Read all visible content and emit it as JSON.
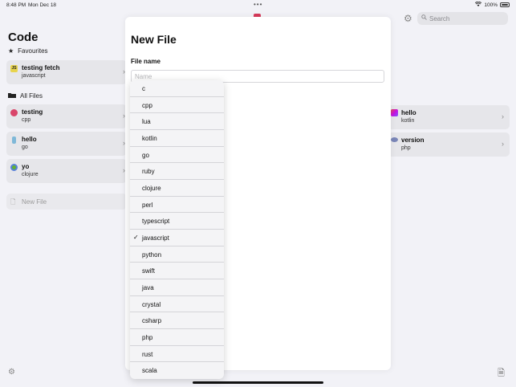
{
  "status_bar": {
    "time": "8:48 PM",
    "date": "Mon Dec 18",
    "battery": "100%"
  },
  "sidebar": {
    "title": "Code",
    "favourites_label": "Favourites",
    "favourites": [
      {
        "name": "testing fetch",
        "language": "javascript",
        "badge": "JS",
        "badge_color": "#e8d44d"
      }
    ],
    "all_files_label": "All Files",
    "files": [
      {
        "name": "testing",
        "language": "cpp",
        "badge_color": "#d9456a"
      },
      {
        "name": "hello",
        "language": "go",
        "badge_color": "#7fb8d8"
      },
      {
        "name": "yo",
        "language": "clojure",
        "badge_color": "#63b132"
      }
    ],
    "new_file_label": "New File"
  },
  "search": {
    "placeholder": "Search"
  },
  "right_files": [
    {
      "name": "hello",
      "language": "kotlin",
      "badge_color": "#c757bc"
    },
    {
      "name": "version",
      "language": "php",
      "badge_color": "#7a86b8"
    }
  ],
  "sheet": {
    "title": "New File",
    "field_label": "File name",
    "input_placeholder": "Name",
    "input_value": ""
  },
  "language_menu": {
    "selected": "javascript",
    "options": [
      "c",
      "cpp",
      "lua",
      "kotlin",
      "go",
      "ruby",
      "clojure",
      "perl",
      "typescript",
      "javascript",
      "python",
      "swift",
      "java",
      "crystal",
      "csharp",
      "php",
      "rust",
      "scala"
    ]
  },
  "colors": {
    "accent": "#d63a5a",
    "background": "#f2f2f7",
    "card": "#e6e6ea"
  }
}
